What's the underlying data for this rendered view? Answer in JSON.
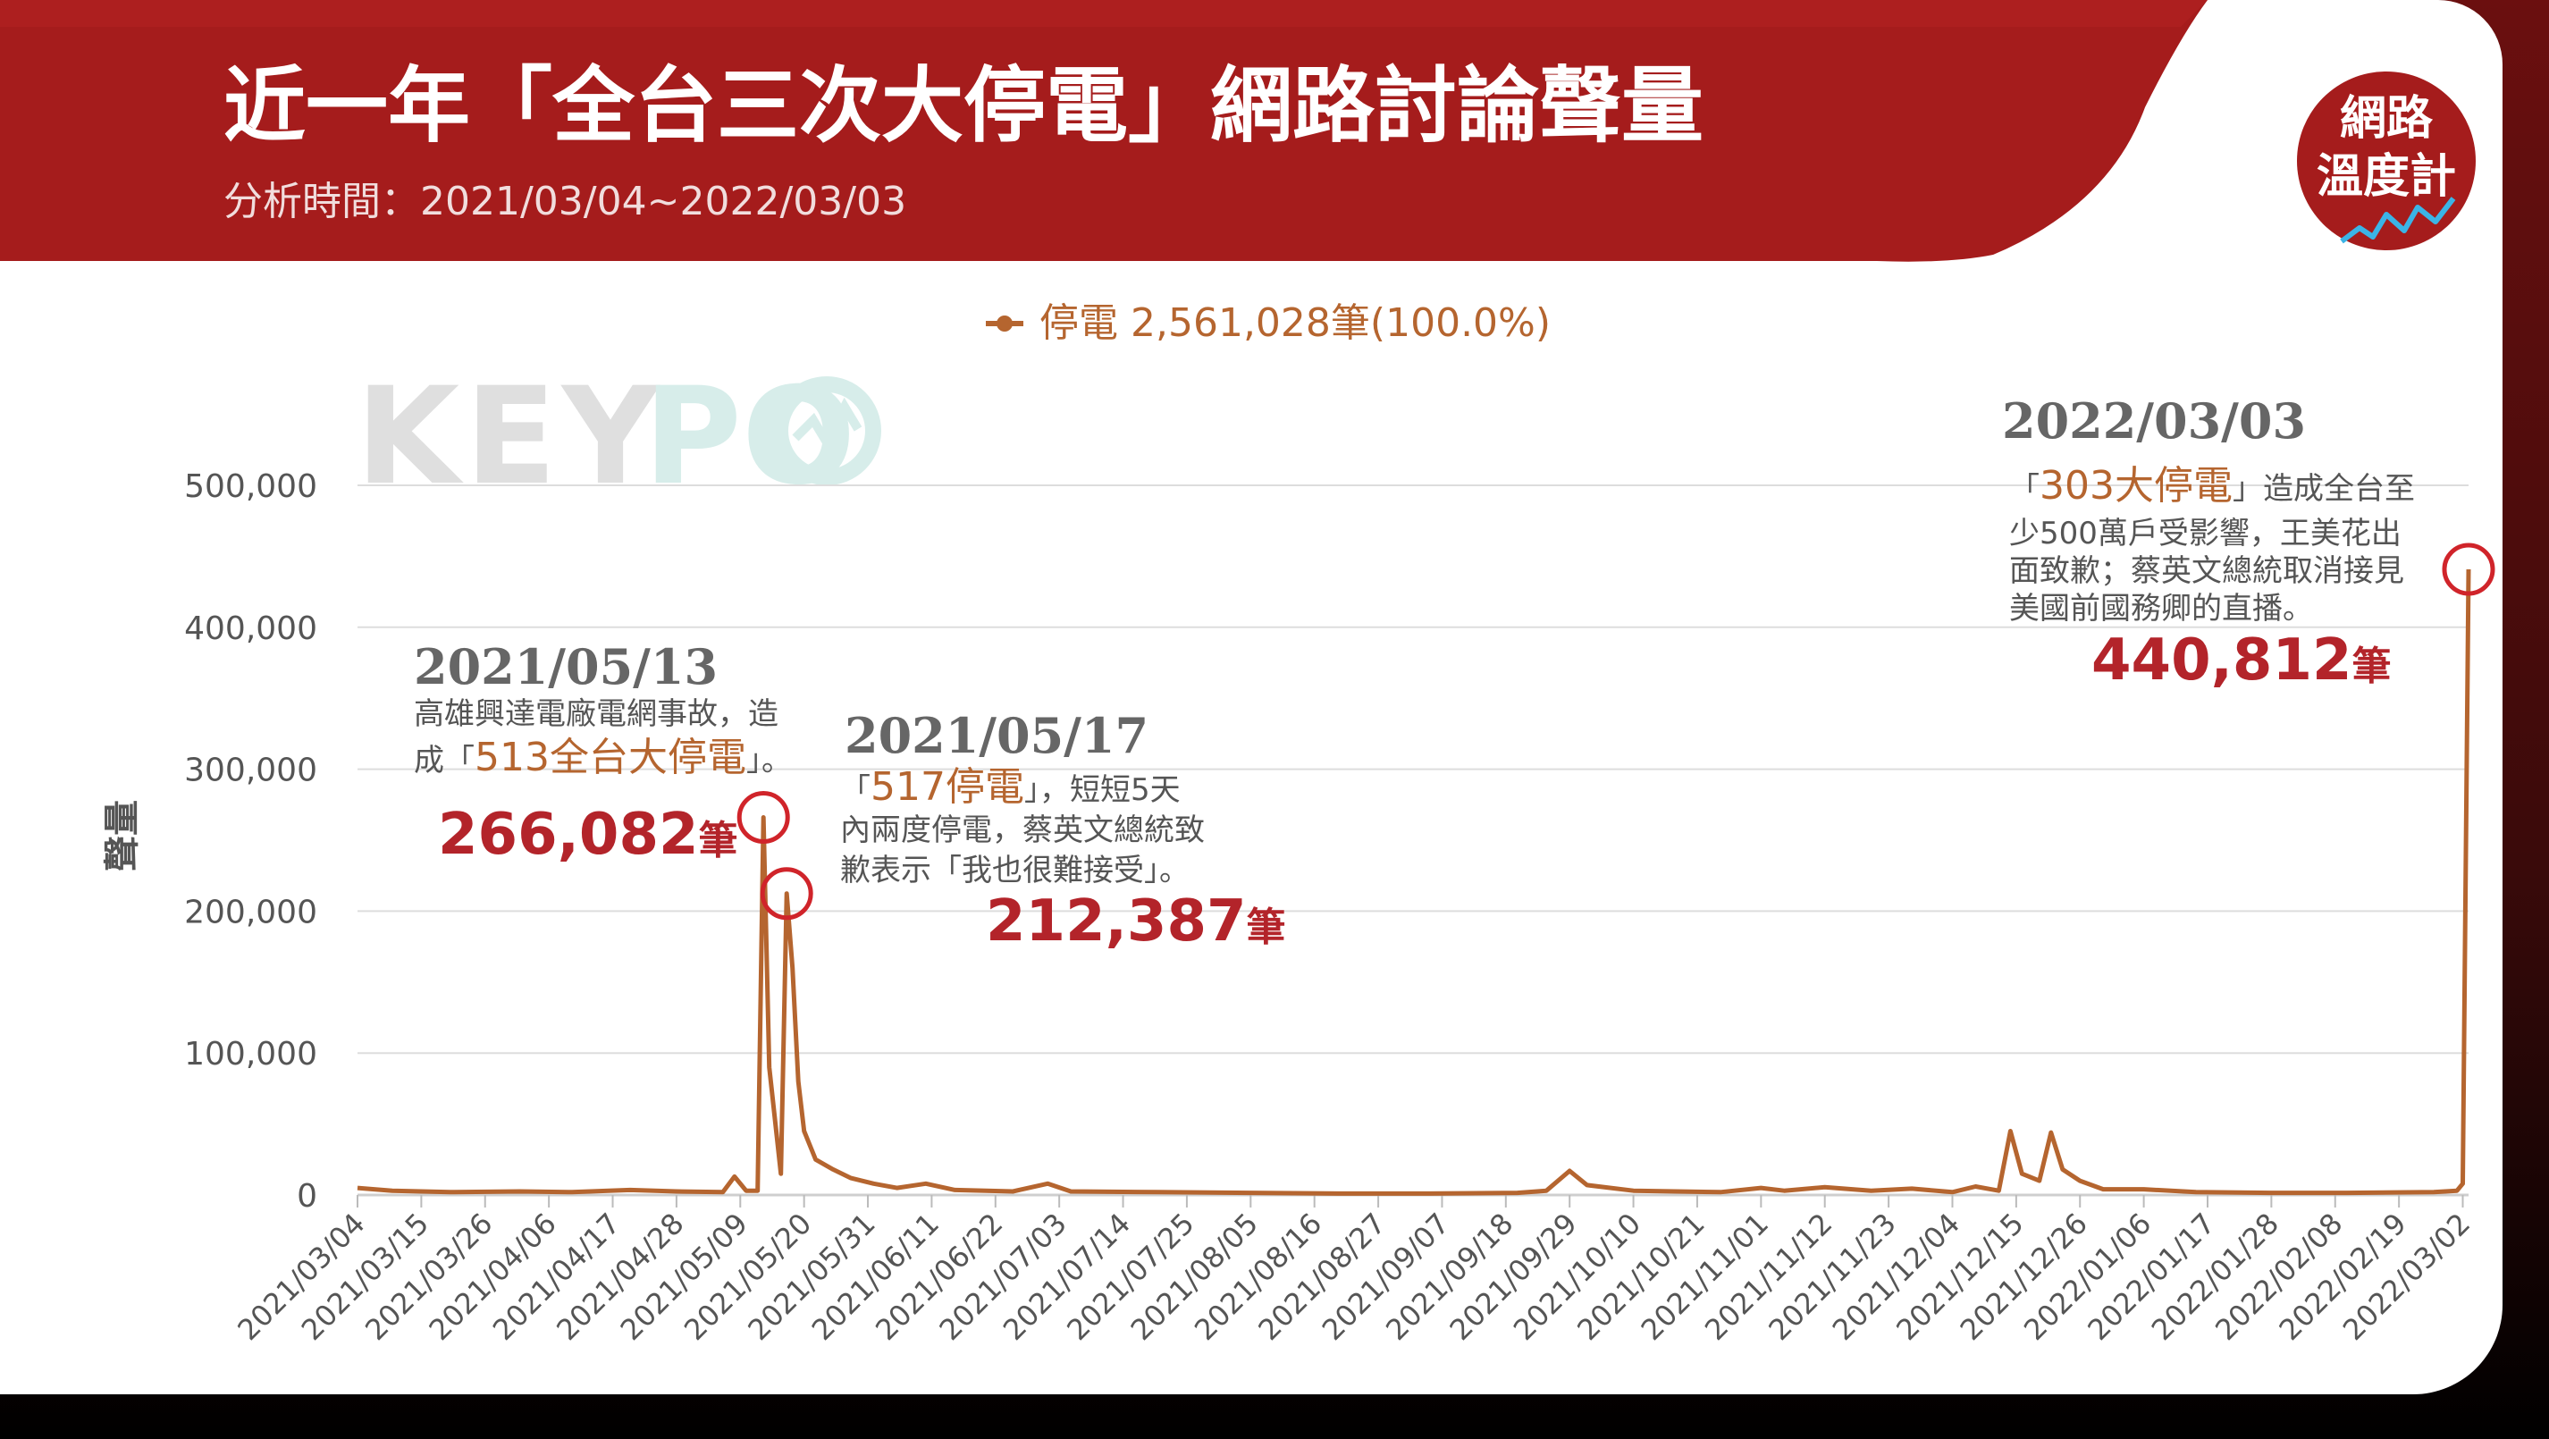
{
  "header": {
    "title": "近一年「全台三次大停電」網路討論聲量",
    "subtitle": "分析時間：2021/03/04~2022/03/03",
    "badge_line1": "網路",
    "badge_line2": "溫度計"
  },
  "watermark": {
    "text_gray": "KEY",
    "text_teal": "PO"
  },
  "colors": {
    "line": "#b5652f",
    "header_red": "#a51c1c",
    "highlight_red": "#b3242a",
    "grid": "#dddddd"
  },
  "chart_data": {
    "type": "line",
    "legend": "停電 2,561,028筆(100.0%)",
    "ylabel": "聲量",
    "xlabel": "",
    "ylim": [
      0,
      500000
    ],
    "y_ticks": [
      "0",
      "100,000",
      "200,000",
      "300,000",
      "400,000",
      "500,000"
    ],
    "x_ticks": [
      "2021/03/04",
      "2021/03/15",
      "2021/03/26",
      "2021/04/06",
      "2021/04/17",
      "2021/04/28",
      "2021/05/09",
      "2021/05/20",
      "2021/05/31",
      "2021/06/11",
      "2021/06/22",
      "2021/07/03",
      "2021/07/14",
      "2021/07/25",
      "2021/08/05",
      "2021/08/16",
      "2021/08/27",
      "2021/09/07",
      "2021/09/18",
      "2021/09/29",
      "2021/10/10",
      "2021/10/21",
      "2021/11/01",
      "2021/11/12",
      "2021/11/23",
      "2021/12/04",
      "2021/12/15",
      "2021/12/26",
      "2022/01/06",
      "2022/01/17",
      "2022/01/28",
      "2022/02/08",
      "2022/02/19",
      "2022/03/02"
    ],
    "series": [
      {
        "name": "停電",
        "points": [
          [
            "2021/03/04",
            5000
          ],
          [
            "2021/03/10",
            3000
          ],
          [
            "2021/03/20",
            2000
          ],
          [
            "2021/04/01",
            2500
          ],
          [
            "2021/04/10",
            2000
          ],
          [
            "2021/04/20",
            3500
          ],
          [
            "2021/04/28",
            2500
          ],
          [
            "2021/05/06",
            2000
          ],
          [
            "2021/05/08",
            13000
          ],
          [
            "2021/05/10",
            3000
          ],
          [
            "2021/05/12",
            3000
          ],
          [
            "2021/05/13",
            266082
          ],
          [
            "2021/05/14",
            90000
          ],
          [
            "2021/05/16",
            15000
          ],
          [
            "2021/05/17",
            212387
          ],
          [
            "2021/05/18",
            160000
          ],
          [
            "2021/05/19",
            80000
          ],
          [
            "2021/05/20",
            45000
          ],
          [
            "2021/05/22",
            25000
          ],
          [
            "2021/05/25",
            18000
          ],
          [
            "2021/05/28",
            12000
          ],
          [
            "2021/06/01",
            8000
          ],
          [
            "2021/06/05",
            5000
          ],
          [
            "2021/06/10",
            8000
          ],
          [
            "2021/06/15",
            3500
          ],
          [
            "2021/06/25",
            2500
          ],
          [
            "2021/07/01",
            8000
          ],
          [
            "2021/07/05",
            2500
          ],
          [
            "2021/07/20",
            2000
          ],
          [
            "2021/08/05",
            1500
          ],
          [
            "2021/08/20",
            1000
          ],
          [
            "2021/09/05",
            1000
          ],
          [
            "2021/09/20",
            1500
          ],
          [
            "2021/09/25",
            3000
          ],
          [
            "2021/09/29",
            17000
          ],
          [
            "2021/10/02",
            7000
          ],
          [
            "2021/10/10",
            3000
          ],
          [
            "2021/10/25",
            2000
          ],
          [
            "2021/11/01",
            5000
          ],
          [
            "2021/11/05",
            3000
          ],
          [
            "2021/11/12",
            5500
          ],
          [
            "2021/11/20",
            3000
          ],
          [
            "2021/11/27",
            4500
          ],
          [
            "2021/12/04",
            2000
          ],
          [
            "2021/12/08",
            6000
          ],
          [
            "2021/12/12",
            3000
          ],
          [
            "2021/12/14",
            45000
          ],
          [
            "2021/12/16",
            15000
          ],
          [
            "2021/12/19",
            10000
          ],
          [
            "2021/12/21",
            44000
          ],
          [
            "2021/12/23",
            18000
          ],
          [
            "2021/12/26",
            10000
          ],
          [
            "2021/12/30",
            4000
          ],
          [
            "2022/01/06",
            4000
          ],
          [
            "2022/01/15",
            2000
          ],
          [
            "2022/01/28",
            1500
          ],
          [
            "2022/02/10",
            1500
          ],
          [
            "2022/02/25",
            2000
          ],
          [
            "2022/03/01",
            3000
          ],
          [
            "2022/03/02",
            8000
          ],
          [
            "2022/03/03",
            440812
          ]
        ]
      }
    ],
    "annotations": [
      {
        "date": "2021/05/13",
        "desc1": "高雄興達電廠電網事故，造",
        "desc2_pre": "成「",
        "desc2_hl": "513全台大停電",
        "desc2_post": "」。",
        "value": "266,082",
        "unit": "筆"
      },
      {
        "date": "2021/05/17",
        "desc1_pre": "「",
        "desc1_hl": "517停電",
        "desc1_post": "」，短短5天",
        "desc2": "內兩度停電，蔡英文總統致",
        "desc3": "歉表示「我也很難接受」。",
        "value": "212,387",
        "unit": "筆"
      },
      {
        "date": "2022/03/03",
        "desc1_pre": "「",
        "desc1_hl": "303大停電",
        "desc1_post": "」造成全台至",
        "desc2": "少500萬戶受影響，王美花出",
        "desc3": "面致歉；蔡英文總統取消接見",
        "desc4": "美國前國務卿的直播。",
        "value": "440,812",
        "unit": "筆"
      }
    ]
  }
}
